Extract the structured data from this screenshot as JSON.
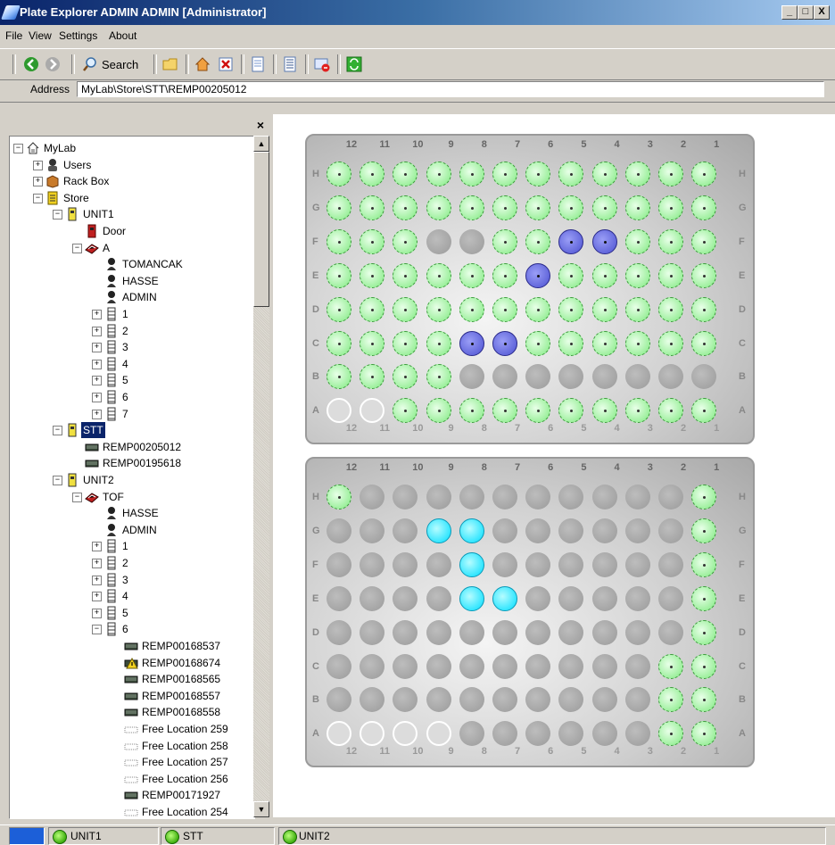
{
  "window": {
    "title": "Plate Explorer ADMIN ADMIN [Administrator]",
    "controls": [
      "_",
      "□",
      "X"
    ]
  },
  "menu": {
    "items": [
      "File",
      "View",
      "Settings",
      "About"
    ]
  },
  "toolbar": {
    "search_label": "Search",
    "icons": [
      "back-icon",
      "forward-icon",
      "search-icon",
      "folder-icon",
      "home-icon",
      "delete-icon",
      "document-icon",
      "properties-icon",
      "remove-icon",
      "refresh-icon"
    ]
  },
  "address": {
    "label": "Address",
    "value": "MyLab\\Store\\STT\\REMP00205012"
  },
  "tree": {
    "close": "×",
    "nodes": [
      {
        "label": "MyLab",
        "icon": "house-icon",
        "expander": "−"
      },
      {
        "label": "Users",
        "icon": "users-icon",
        "expander": "+"
      },
      {
        "label": "Rack Box",
        "icon": "box-icon",
        "expander": "+"
      },
      {
        "label": "Store",
        "icon": "store-icon",
        "expander": "−"
      },
      {
        "label": "UNIT1",
        "icon": "unit-icon",
        "expander": "−"
      },
      {
        "label": "Door",
        "icon": "door-icon",
        "expander": ""
      },
      {
        "label": "A",
        "icon": "rack-icon",
        "expander": "−"
      },
      {
        "label": "TOMANCAK",
        "icon": "user-icon",
        "expander": ""
      },
      {
        "label": "HASSE",
        "icon": "user-icon",
        "expander": ""
      },
      {
        "label": "ADMIN",
        "icon": "user-icon",
        "expander": ""
      },
      {
        "label": "1",
        "icon": "shelf-icon",
        "expander": "+"
      },
      {
        "label": "2",
        "icon": "shelf-icon",
        "expander": "+"
      },
      {
        "label": "3",
        "icon": "shelf-icon",
        "expander": "+"
      },
      {
        "label": "4",
        "icon": "shelf-icon",
        "expander": "+"
      },
      {
        "label": "5",
        "icon": "shelf-icon",
        "expander": "+"
      },
      {
        "label": "6",
        "icon": "shelf-icon",
        "expander": "+"
      },
      {
        "label": "7",
        "icon": "shelf-icon",
        "expander": "+"
      },
      {
        "label": "STT",
        "icon": "unit-icon",
        "expander": "−",
        "selected": true
      },
      {
        "label": "REMP00205012",
        "icon": "plate-icon",
        "expander": ""
      },
      {
        "label": "REMP00195618",
        "icon": "plate-icon",
        "expander": ""
      },
      {
        "label": "UNIT2",
        "icon": "unit-icon",
        "expander": "−"
      },
      {
        "label": "TOF",
        "icon": "rack-icon",
        "expander": "−"
      },
      {
        "label": "HASSE",
        "icon": "user-icon",
        "expander": ""
      },
      {
        "label": "ADMIN",
        "icon": "user-icon",
        "expander": ""
      },
      {
        "label": "1",
        "icon": "shelf-icon",
        "expander": "+"
      },
      {
        "label": "2",
        "icon": "shelf-icon",
        "expander": "+"
      },
      {
        "label": "3",
        "icon": "shelf-icon",
        "expander": "+"
      },
      {
        "label": "4",
        "icon": "shelf-icon",
        "expander": "+"
      },
      {
        "label": "5",
        "icon": "shelf-icon",
        "expander": "+"
      },
      {
        "label": "6",
        "icon": "shelf-icon",
        "expander": "−"
      },
      {
        "label": "REMP00168537",
        "icon": "plate-icon",
        "expander": ""
      },
      {
        "label": "REMP00168674",
        "icon": "plate-warning-icon",
        "expander": ""
      },
      {
        "label": "REMP00168565",
        "icon": "plate-icon",
        "expander": ""
      },
      {
        "label": "REMP00168557",
        "icon": "plate-icon",
        "expander": ""
      },
      {
        "label": "REMP00168558",
        "icon": "plate-icon",
        "expander": ""
      },
      {
        "label": "Free Location 259",
        "icon": "free-slot-icon",
        "expander": ""
      },
      {
        "label": "Free Location 258",
        "icon": "free-slot-icon",
        "expander": ""
      },
      {
        "label": "Free Location 257",
        "icon": "free-slot-icon",
        "expander": ""
      },
      {
        "label": "Free Location 256",
        "icon": "free-slot-icon",
        "expander": ""
      },
      {
        "label": "REMP00171927",
        "icon": "plate-icon",
        "expander": ""
      },
      {
        "label": "Free Location 254",
        "icon": "free-slot-icon",
        "expander": ""
      }
    ]
  },
  "plates": [
    {
      "columns": [
        "12",
        "11",
        "10",
        "9",
        "8",
        "7",
        "6",
        "5",
        "4",
        "3",
        "2",
        "1"
      ],
      "rows": [
        "H",
        "G",
        "F",
        "E",
        "D",
        "C",
        "B",
        "A"
      ],
      "wells": [
        [
          "green",
          "green",
          "green",
          "green",
          "green",
          "green",
          "green",
          "green",
          "green",
          "green",
          "green",
          "green"
        ],
        [
          "green",
          "green",
          "green",
          "green",
          "green",
          "green",
          "green",
          "green",
          "green",
          "green",
          "green",
          "green"
        ],
        [
          "green",
          "green",
          "green",
          "gray",
          "gray",
          "green",
          "green",
          "blue",
          "blue",
          "green",
          "green",
          "green"
        ],
        [
          "green",
          "green",
          "green",
          "green",
          "green",
          "green",
          "blue",
          "green",
          "green",
          "green",
          "green",
          "green"
        ],
        [
          "green",
          "green",
          "green",
          "green",
          "green",
          "green",
          "green",
          "green",
          "green",
          "green",
          "green",
          "green"
        ],
        [
          "green",
          "green",
          "green",
          "green",
          "blue",
          "blue",
          "green",
          "green",
          "green",
          "green",
          "green",
          "green"
        ],
        [
          "green",
          "green",
          "green",
          "green",
          "gray",
          "gray",
          "gray",
          "gray",
          "gray",
          "gray",
          "gray",
          "gray"
        ],
        [
          "white",
          "white",
          "green",
          "green",
          "green",
          "green",
          "green",
          "green",
          "green",
          "green",
          "green",
          "green"
        ]
      ]
    },
    {
      "columns": [
        "12",
        "11",
        "10",
        "9",
        "8",
        "7",
        "6",
        "5",
        "4",
        "3",
        "2",
        "1"
      ],
      "rows": [
        "H",
        "G",
        "F",
        "E",
        "D",
        "C",
        "B",
        "A"
      ],
      "wells": [
        [
          "green",
          "gray",
          "gray",
          "gray",
          "gray",
          "gray",
          "gray",
          "gray",
          "gray",
          "gray",
          "gray",
          "green"
        ],
        [
          "gray",
          "gray",
          "gray",
          "cyan",
          "cyan",
          "gray",
          "gray",
          "gray",
          "gray",
          "gray",
          "gray",
          "green"
        ],
        [
          "gray",
          "gray",
          "gray",
          "gray",
          "cyan",
          "gray",
          "gray",
          "gray",
          "gray",
          "gray",
          "gray",
          "green"
        ],
        [
          "gray",
          "gray",
          "gray",
          "gray",
          "cyan",
          "cyan",
          "gray",
          "gray",
          "gray",
          "gray",
          "gray",
          "green"
        ],
        [
          "gray",
          "gray",
          "gray",
          "gray",
          "gray",
          "gray",
          "gray",
          "gray",
          "gray",
          "gray",
          "gray",
          "green"
        ],
        [
          "gray",
          "gray",
          "gray",
          "gray",
          "gray",
          "gray",
          "gray",
          "gray",
          "gray",
          "gray",
          "green",
          "green"
        ],
        [
          "gray",
          "gray",
          "gray",
          "gray",
          "gray",
          "gray",
          "gray",
          "gray",
          "gray",
          "gray",
          "green",
          "green"
        ],
        [
          "white",
          "white",
          "white",
          "white",
          "gray",
          "gray",
          "gray",
          "gray",
          "gray",
          "gray",
          "green",
          "green"
        ]
      ]
    }
  ],
  "status": {
    "panels": [
      "UNIT1",
      "STT",
      "UNIT2"
    ]
  },
  "colors": {
    "titlebar": "#0a246a",
    "well_green": "#9ff09f",
    "well_blue": "#5b60d8",
    "well_cyan": "#33e6ff",
    "well_gray": "#9a9a9a"
  }
}
